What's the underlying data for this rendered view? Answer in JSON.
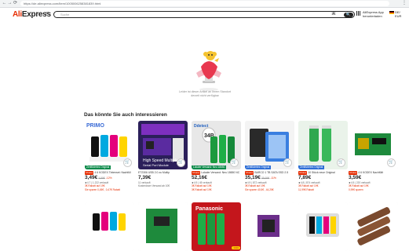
{
  "browser": {
    "url": "https://de.aliexpress.com/item/1005006258381839.html",
    "back": "←",
    "forward": "→",
    "reload": "⟳",
    "menu": "⋮"
  },
  "header": {
    "logo_red": "Ali",
    "logo_dark": "Express",
    "search_placeholder": "Suche",
    "search_button": "🔍",
    "app_line1": "AliExpress App",
    "app_line2": "herunterladen",
    "lang_line1": "DE/",
    "lang_line2": "EUR"
  },
  "empty_state": {
    "line1": "Leider ist dieser Artikel an Ihrem Standort",
    "line2": "derzeit nicht verfügbar"
  },
  "section": {
    "title": "Das könnte Sie auch interessieren"
  },
  "colors": {
    "accent": "#e62e04",
    "choice_green": "#0b8a4a",
    "cert_blue": "#2f6fd6"
  },
  "products": [
    {
      "title_badge": "Choice",
      "title": "4 6 KODEX Tintenset: Nachfüll",
      "price": "3,49€",
      "old_price": "3,99€",
      "discount": "-12%",
      "rating": "4.7",
      "sold": "1.222 verkauft",
      "promo": "3€ Rabatt auf 19€",
      "extra": "Sie sparen 0,45€ , 0,47€ Rabatt",
      "tag": "Zertifiziertes Original",
      "tag_style": "green",
      "image": "ink-bottles"
    },
    {
      "title_badge": "",
      "title": "ET2306 USB 2.0 zu Multip",
      "price": "7,39€",
      "old_price": "",
      "discount": "",
      "rating": "",
      "sold": "11 verkauft",
      "promo": "Kostenloser Versand ab 10€",
      "extra": "",
      "tag": "",
      "tag_style": "",
      "image": "pcb-board"
    },
    {
      "title_badge": "Choice",
      "title": "Lokaler Versand: Neu 18650 NC",
      "price": "52,16€",
      "old_price": "",
      "discount": "",
      "rating": "4.9",
      "sold": "45 verkauft",
      "promo": "3€ Rabatt auf 19€",
      "extra": "3€ Rabatt auf 19€",
      "tag": "Lokaler Versand: Neu 18650",
      "tag_style": "green",
      "image": "batteries-green"
    },
    {
      "title_badge": "Choice",
      "title": "BARCO 1 TB SATA SSD 2.5",
      "price": "35,19€",
      "old_price": "39,69€",
      "discount": "-11%",
      "rating": "4.9",
      "sold": "872 verkauft",
      "promo": "3€ Rabatt auf 19€",
      "extra": "Sie sparen 40,5€ , 44,25€",
      "tag": "Zertifiziertes Original",
      "tag_style": "blue",
      "image": "ssd-box"
    },
    {
      "title_badge": "Choice",
      "title": "10 Stück neue Original",
      "price": "7,89€",
      "old_price": "",
      "discount": "",
      "rating": "4.8",
      "sold": "874 verkauft",
      "promo": "3€ Rabatt auf 19€",
      "extra": "11,99€ Rabatt",
      "tag": "Zertifiziertes Original",
      "tag_style": "blue",
      "image": "batteries-2"
    },
    {
      "title_badge": "Choice",
      "title": "4 6 KODEX Nachfüllt",
      "price": "3,59€",
      "old_price": "",
      "discount": "",
      "rating": "4.5",
      "sold": "220 verkauft",
      "promo": "3€ Rabatt auf 19€",
      "extra": "0,99€ sparen",
      "tag": "",
      "tag_style": "",
      "image": "chip-pcb"
    },
    {
      "image": "ink-bottles-2"
    },
    {
      "image": "green-pcb"
    },
    {
      "image": "panasonic-batteries",
      "badge": "3400"
    },
    {
      "image": "pcb-purple"
    },
    {
      "image": "ink-cartridge"
    },
    {
      "image": "brown-batteries"
    }
  ]
}
